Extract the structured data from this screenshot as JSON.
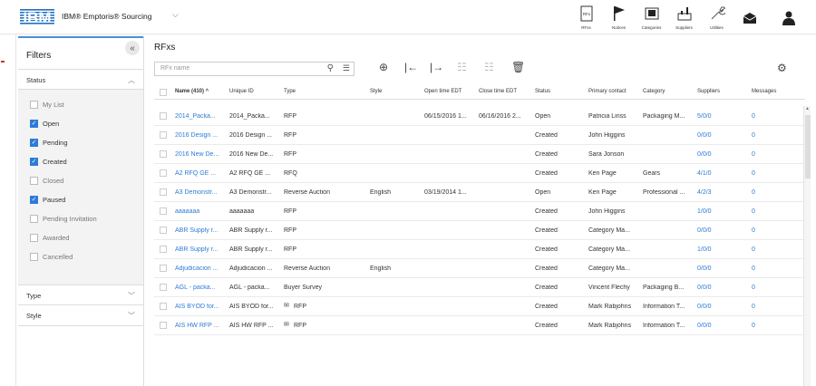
{
  "app": {
    "brand_logo": "IBM",
    "title": "IBM® Emptoris® Sourcing"
  },
  "nav": [
    {
      "icon": "rfx-doc-icon",
      "label": "RFxs"
    },
    {
      "icon": "flag-icon",
      "label": "Notices"
    },
    {
      "icon": "categories-icon",
      "label": "Categories"
    },
    {
      "icon": "suppliers-icon",
      "label": "Suppliers"
    },
    {
      "icon": "wrench-icon",
      "label": "Utilities"
    }
  ],
  "filters": {
    "title": "Filters",
    "collapse_glyph": "«",
    "status_label": "Status",
    "status_options": [
      {
        "label": "My List",
        "checked": false
      },
      {
        "label": "Open",
        "checked": true
      },
      {
        "label": "Pending",
        "checked": true
      },
      {
        "label": "Created",
        "checked": true
      },
      {
        "label": "Closed",
        "checked": false
      },
      {
        "label": "Paused",
        "checked": true
      },
      {
        "label": "Pending Invitation",
        "checked": false
      },
      {
        "label": "Awarded",
        "checked": false
      },
      {
        "label": "Cancelled",
        "checked": false
      }
    ],
    "type_label": "Type",
    "style_label": "Style"
  },
  "main": {
    "title": "RFxs",
    "search_placeholder": "RFx name",
    "columns": {
      "name": "Name (410) ^",
      "unique_id": "Unique ID",
      "type": "Type",
      "style": "Style",
      "open_time": "Open time EDT",
      "close_time": "Close time EDT",
      "status": "Status",
      "primary_contact": "Primary contact",
      "category": "Category",
      "suppliers": "Suppliers",
      "messages": "Messages"
    },
    "rows": [
      {
        "name": "2014_Packa...",
        "uid": "2014_Packa...",
        "type": "RFP",
        "style": "",
        "open": "06/15/2016 1...",
        "close": "06/16/2016 2...",
        "status": "Open",
        "contact": "Patricia Linss",
        "category": "Packaging M...",
        "suppliers": "5/0/0",
        "messages": "0"
      },
      {
        "name": "2016 Design ...",
        "uid": "2016 Design ...",
        "type": "RFP",
        "style": "",
        "open": "",
        "close": "",
        "status": "Created",
        "contact": "John Higgins",
        "category": "",
        "suppliers": "0/0/0",
        "messages": "0"
      },
      {
        "name": "2016 New De...",
        "uid": "2016 New De...",
        "type": "RFP",
        "style": "",
        "open": "",
        "close": "",
        "status": "Created",
        "contact": "Sara Jonson",
        "category": "",
        "suppliers": "0/0/0",
        "messages": "0"
      },
      {
        "name": "A2 RFQ GE ...",
        "uid": "A2 RFQ GE ...",
        "type": "RFQ",
        "style": "",
        "open": "",
        "close": "",
        "status": "Created",
        "contact": "Ken Page",
        "category": "Gears",
        "suppliers": "4/1/0",
        "messages": "0"
      },
      {
        "name": "A3 Demonstr...",
        "uid": "A3 Demonstr...",
        "type": "Reverse Auction",
        "style": "English",
        "open": "03/19/2014 1...",
        "close": "",
        "status": "Open",
        "contact": "Ken Page",
        "category": "Professional ...",
        "suppliers": "4/2/3",
        "messages": "0"
      },
      {
        "name": "aaaaaaa",
        "uid": "aaaaaaa",
        "type": "RFP",
        "style": "",
        "open": "",
        "close": "",
        "status": "Created",
        "contact": "John Higgins",
        "category": "",
        "suppliers": "1/0/0",
        "messages": "0"
      },
      {
        "name": "ABR Supply r...",
        "uid": "ABR Supply r...",
        "type": "RFP",
        "style": "",
        "open": "",
        "close": "",
        "status": "Created",
        "contact": "Category Ma...",
        "category": "",
        "suppliers": "0/0/0",
        "messages": "0"
      },
      {
        "name": "ABR Supply r...",
        "uid": "ABR Supply r...",
        "type": "RFP",
        "style": "",
        "open": "",
        "close": "",
        "status": "Created",
        "contact": "Category Ma...",
        "category": "",
        "suppliers": "1/0/0",
        "messages": "0"
      },
      {
        "name": "Adjudicacion ...",
        "uid": "Adjudicacion ...",
        "type": "Reverse Auction",
        "style": "English",
        "open": "",
        "close": "",
        "status": "Created",
        "contact": "Category Ma...",
        "category": "",
        "suppliers": "0/0/0",
        "messages": "0"
      },
      {
        "name": "AGL - packa...",
        "uid": "AGL - packa...",
        "type": "Buyer Survey",
        "style": "",
        "open": "",
        "close": "",
        "status": "Created",
        "contact": "Vincent Flechy",
        "category": "Packaging B...",
        "suppliers": "0/0/0",
        "messages": "0"
      },
      {
        "name": "AIS BYOD for...",
        "uid": "AIS BYOD for...",
        "type": "RFP",
        "style": "",
        "open": "",
        "close": "",
        "status": "Created",
        "contact": "Mark Rabjohns",
        "category": "Information T...",
        "suppliers": "0/0/0",
        "messages": "0",
        "icon": true
      },
      {
        "name": "AIS HW RFP ...",
        "uid": "AIS HW RFP ...",
        "type": "RFP",
        "style": "",
        "open": "",
        "close": "",
        "status": "Created",
        "contact": "Mark Rabjohns",
        "category": "Information T...",
        "suppliers": "0/0/0",
        "messages": "0",
        "icon": true
      }
    ]
  },
  "colors": {
    "accent": "#2d7bd6",
    "filter_bg": "#f3f3f3"
  }
}
